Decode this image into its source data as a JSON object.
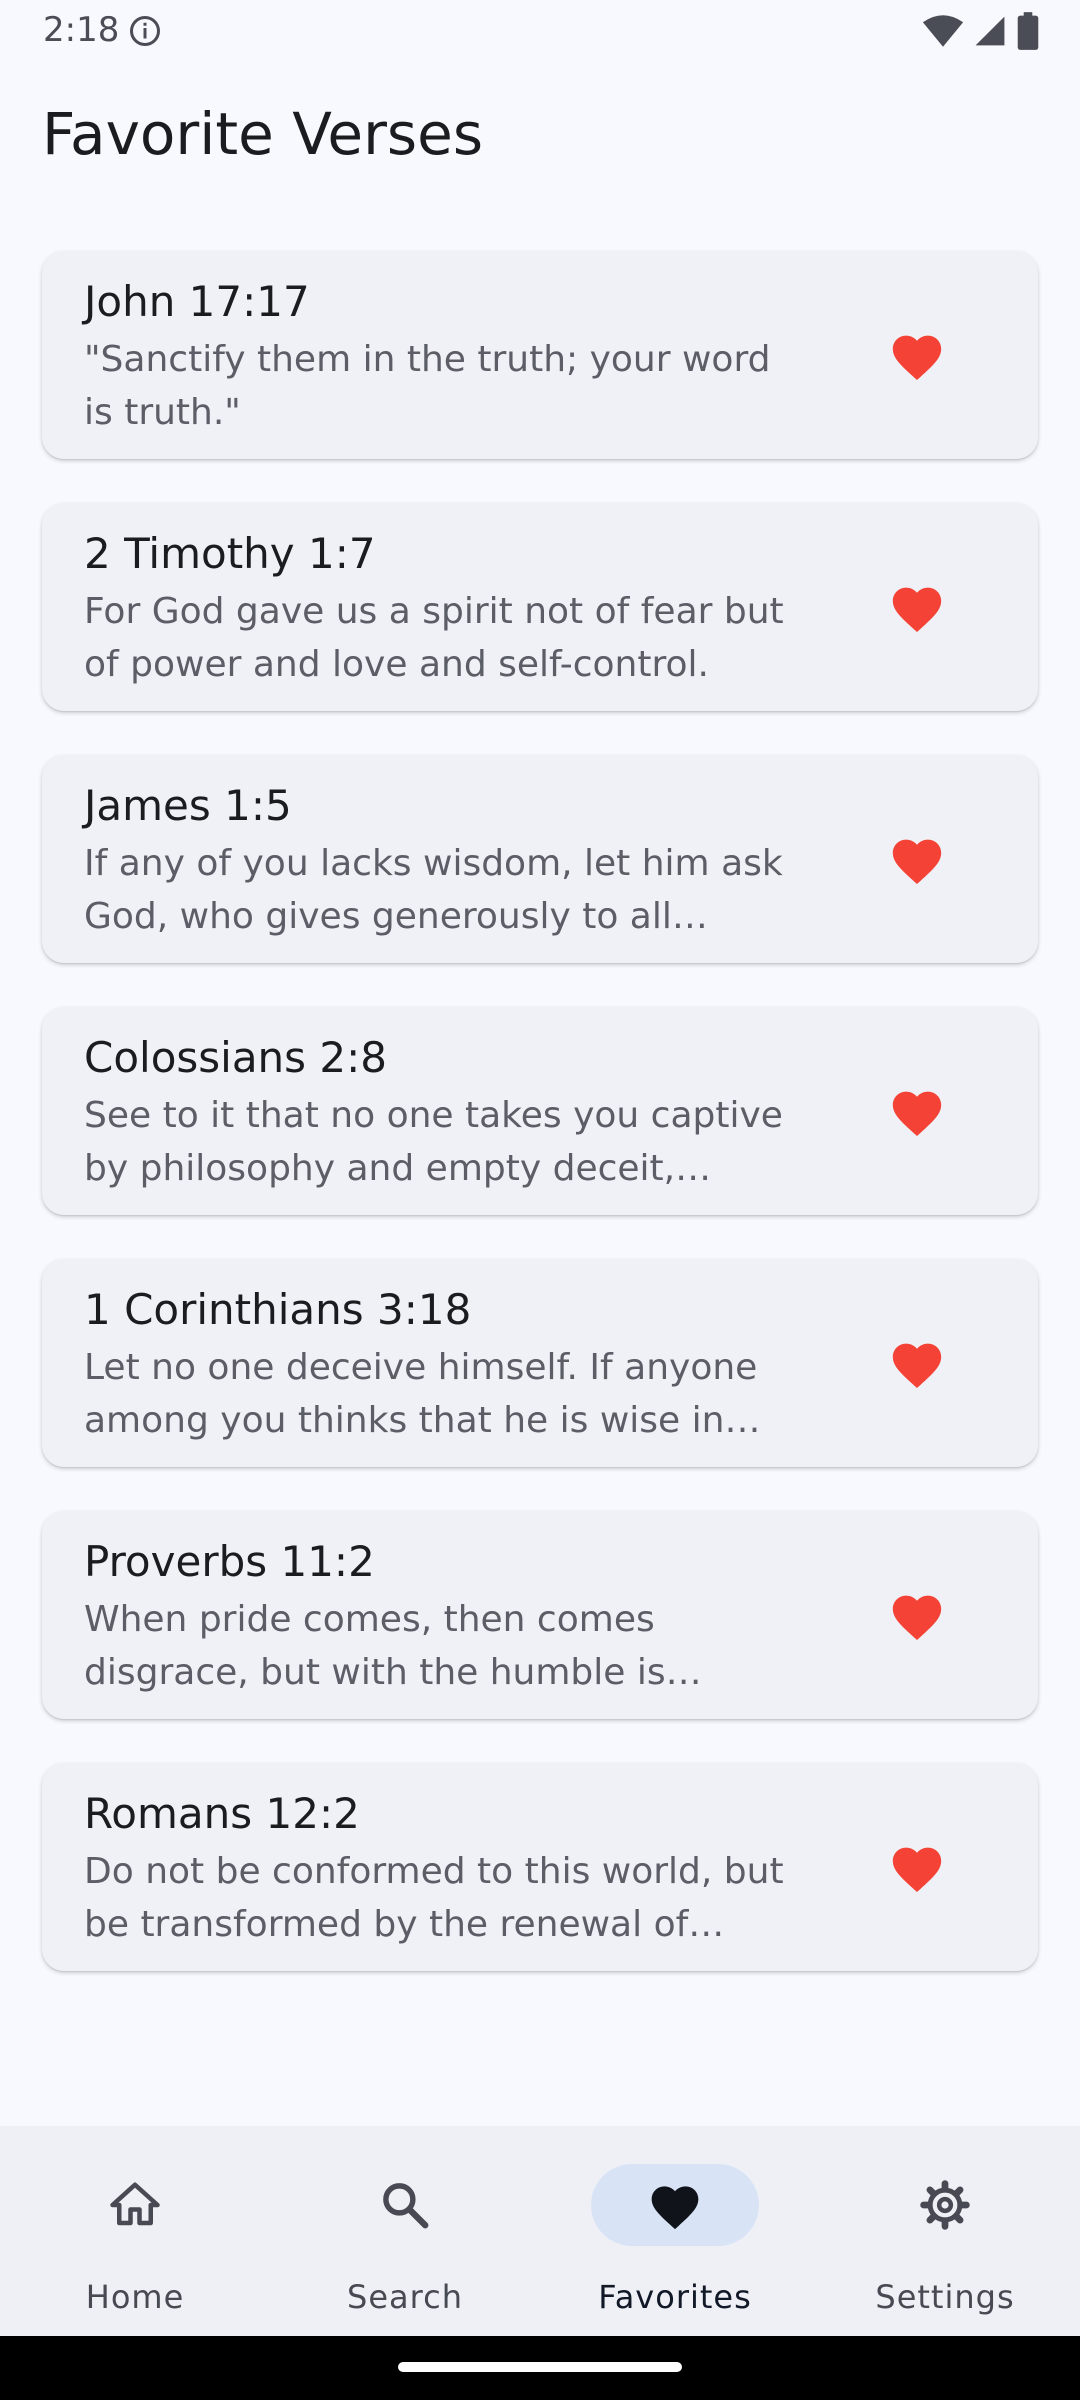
{
  "status_bar": {
    "time": "2:18",
    "info_icon": "info-icon",
    "wifi_icon": "wifi-icon",
    "signal_icon": "signal-icon",
    "battery_icon": "battery-icon"
  },
  "page": {
    "title": "Favorite Verses"
  },
  "colors": {
    "background": "#f8f9fe",
    "card": "#f0f1f6",
    "heart": "#f44336",
    "nav_active_pill": "#d9e3f6",
    "nav_background": "#eef0f5"
  },
  "verses": [
    {
      "reference": "John 17:17",
      "text": "\"Sanctify them in the truth; your word is truth.\"",
      "favorite_icon": "heart-icon"
    },
    {
      "reference": "2 Timothy 1:7",
      "text": "For God gave us a spirit not of fear but of power and love and self-control.",
      "favorite_icon": "heart-icon"
    },
    {
      "reference": "James 1:5",
      "text": "If any of you lacks wisdom, let him ask God, who gives generously to all witho…",
      "favorite_icon": "heart-icon"
    },
    {
      "reference": "Colossians 2:8",
      "text": "See to it that no one takes you captive by philosophy and empty deceit, accor…",
      "favorite_icon": "heart-icon"
    },
    {
      "reference": "1 Corinthians 3:18",
      "text": "Let no one deceive himself. If anyone among you thinks that he is wise in thi…",
      "favorite_icon": "heart-icon"
    },
    {
      "reference": "Proverbs 11:2",
      "text": "When pride comes, then comes disgrace, but with the humble is wisdo…",
      "favorite_icon": "heart-icon"
    },
    {
      "reference": "Romans 12:2",
      "text": "Do not be conformed to this world, but be transformed by the renewal of your…",
      "favorite_icon": "heart-icon"
    }
  ],
  "bottom_nav": {
    "items": [
      {
        "label": "Home",
        "icon": "home-icon"
      },
      {
        "label": "Search",
        "icon": "search-icon"
      },
      {
        "label": "Favorites",
        "icon": "heart-icon"
      },
      {
        "label": "Settings",
        "icon": "gear-icon"
      }
    ],
    "active": "Favorites"
  }
}
